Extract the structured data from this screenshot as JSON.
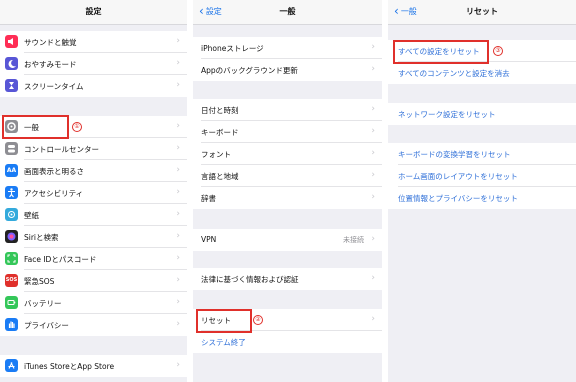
{
  "panel1": {
    "title": "設定",
    "items": [
      {
        "label": "サウンドと触覚",
        "icon": "speaker-icon",
        "color": "#ff2d55"
      },
      {
        "label": "おやすみモード",
        "icon": "moon-icon",
        "color": "#5856d6"
      },
      {
        "label": "スクリーンタイム",
        "icon": "hourglass-icon",
        "color": "#5856d6"
      },
      {
        "label": "一般",
        "icon": "gear-icon",
        "color": "#8e8e93"
      },
      {
        "label": "コントロールセンター",
        "icon": "switches-icon",
        "color": "#8e8e93"
      },
      {
        "label": "画面表示と明るさ",
        "icon": "aa-icon",
        "color": "#1a7cf5"
      },
      {
        "label": "アクセシビリティ",
        "icon": "accessibility-icon",
        "color": "#1a7cf5"
      },
      {
        "label": "壁紙",
        "icon": "wallpaper-icon",
        "color": "#34aadc"
      },
      {
        "label": "Siriと検索",
        "icon": "siri-icon",
        "color": "#222222"
      },
      {
        "label": "Face IDとパスコード",
        "icon": "faceid-icon",
        "color": "#34c759"
      },
      {
        "label": "緊急SOS",
        "icon": "sos-icon",
        "color": "#e0302b"
      },
      {
        "label": "バッテリー",
        "icon": "battery-icon",
        "color": "#34c759"
      },
      {
        "label": "プライバシー",
        "icon": "hand-icon",
        "color": "#1a7cf5"
      },
      {
        "label": "iTunes StoreとApp Store",
        "icon": "appstore-icon",
        "color": "#1a7cf5"
      }
    ],
    "icon_glyphs": {
      "aa": "AA",
      "sos": "SOS"
    },
    "badge": "①"
  },
  "panel2": {
    "back": "設定",
    "title": "一般",
    "items": [
      {
        "label": "iPhoneストレージ"
      },
      {
        "label": "Appのバックグラウンド更新"
      },
      {
        "label": "日付と時刻"
      },
      {
        "label": "キーボード"
      },
      {
        "label": "フォント"
      },
      {
        "label": "言語と地域"
      },
      {
        "label": "辞書"
      },
      {
        "label": "VPN",
        "value": "未接続"
      },
      {
        "label": "法律に基づく情報および認証"
      },
      {
        "label": "リセット"
      },
      {
        "label": "システム終了"
      }
    ],
    "badge": "②"
  },
  "panel3": {
    "back": "一般",
    "title": "リセット",
    "items": [
      {
        "label": "すべての設定をリセット"
      },
      {
        "label": "すべてのコンテンツと設定を消去"
      },
      {
        "label": "ネットワーク設定をリセット"
      },
      {
        "label": "キーボードの変換学習をリセット"
      },
      {
        "label": "ホーム画面のレイアウトをリセット"
      },
      {
        "label": "位置情報とプライバシーをリセット"
      }
    ],
    "badge": "③"
  },
  "colors": {
    "accent": "#2e6fd8",
    "highlight": "#e0302b"
  }
}
